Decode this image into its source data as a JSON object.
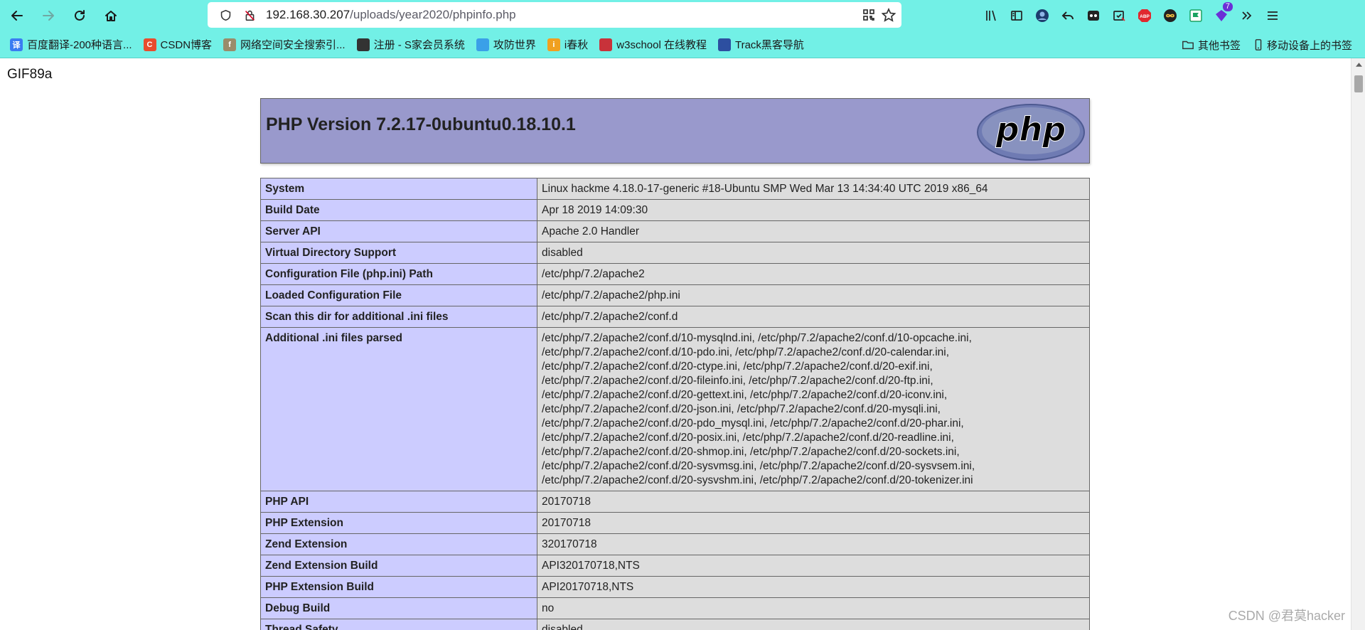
{
  "browser": {
    "url_host": "192.168.30.207",
    "url_path": "/uploads/year2020/phpinfo.php",
    "extension_badge": "7"
  },
  "bookmarks": {
    "items": [
      {
        "label": "百度翻译-200种语言...",
        "icon_text": "译",
        "color": "#3b7cf2"
      },
      {
        "label": "CSDN博客",
        "icon_text": "C",
        "color": "#e84d2e"
      },
      {
        "label": "网络空间安全搜索引...",
        "icon_text": "f",
        "color": "#9a8c6a"
      },
      {
        "label": "注册 - S家会员系统",
        "icon_text": "",
        "color": "#333333"
      },
      {
        "label": "攻防世界",
        "icon_text": "",
        "color": "#3aa0e8"
      },
      {
        "label": "i春秋",
        "icon_text": "i",
        "color": "#f0a020"
      },
      {
        "label": "w3school 在线教程",
        "icon_text": "",
        "color": "#c8323a"
      },
      {
        "label": "Track黑客导航",
        "icon_text": "",
        "color": "#2d4fa0"
      }
    ],
    "other_label": "其他书签",
    "mobile_label": "移动设备上的书签"
  },
  "page": {
    "gif_text": "GIF89a",
    "php_version_title": "PHP Version 7.2.17-0ubuntu0.18.10.1",
    "rows": [
      {
        "key": "System",
        "value": "Linux hackme 4.18.0-17-generic #18-Ubuntu SMP Wed Mar 13 14:34:40 UTC 2019 x86_64"
      },
      {
        "key": "Build Date",
        "value": "Apr 18 2019 14:09:30"
      },
      {
        "key": "Server API",
        "value": "Apache 2.0 Handler"
      },
      {
        "key": "Virtual Directory Support",
        "value": "disabled"
      },
      {
        "key": "Configuration File (php.ini) Path",
        "value": "/etc/php/7.2/apache2"
      },
      {
        "key": "Loaded Configuration File",
        "value": "/etc/php/7.2/apache2/php.ini"
      },
      {
        "key": "Scan this dir for additional .ini files",
        "value": "/etc/php/7.2/apache2/conf.d"
      },
      {
        "key": "Additional .ini files parsed",
        "value": "/etc/php/7.2/apache2/conf.d/10-mysqlnd.ini, /etc/php/7.2/apache2/conf.d/10-opcache.ini, /etc/php/7.2/apache2/conf.d/10-pdo.ini, /etc/php/7.2/apache2/conf.d/20-calendar.ini, /etc/php/7.2/apache2/conf.d/20-ctype.ini, /etc/php/7.2/apache2/conf.d/20-exif.ini, /etc/php/7.2/apache2/conf.d/20-fileinfo.ini, /etc/php/7.2/apache2/conf.d/20-ftp.ini, /etc/php/7.2/apache2/conf.d/20-gettext.ini, /etc/php/7.2/apache2/conf.d/20-iconv.ini, /etc/php/7.2/apache2/conf.d/20-json.ini, /etc/php/7.2/apache2/conf.d/20-mysqli.ini, /etc/php/7.2/apache2/conf.d/20-pdo_mysql.ini, /etc/php/7.2/apache2/conf.d/20-phar.ini, /etc/php/7.2/apache2/conf.d/20-posix.ini, /etc/php/7.2/apache2/conf.d/20-readline.ini, /etc/php/7.2/apache2/conf.d/20-shmop.ini, /etc/php/7.2/apache2/conf.d/20-sockets.ini, /etc/php/7.2/apache2/conf.d/20-sysvmsg.ini, /etc/php/7.2/apache2/conf.d/20-sysvsem.ini, /etc/php/7.2/apache2/conf.d/20-sysvshm.ini, /etc/php/7.2/apache2/conf.d/20-tokenizer.ini"
      },
      {
        "key": "PHP API",
        "value": "20170718"
      },
      {
        "key": "PHP Extension",
        "value": "20170718"
      },
      {
        "key": "Zend Extension",
        "value": "320170718"
      },
      {
        "key": "Zend Extension Build",
        "value": "API320170718,NTS"
      },
      {
        "key": "PHP Extension Build",
        "value": "API20170718,NTS"
      },
      {
        "key": "Debug Build",
        "value": "no"
      },
      {
        "key": "Thread Safety",
        "value": "disabled"
      }
    ]
  },
  "watermark": "CSDN @君莫hacker"
}
